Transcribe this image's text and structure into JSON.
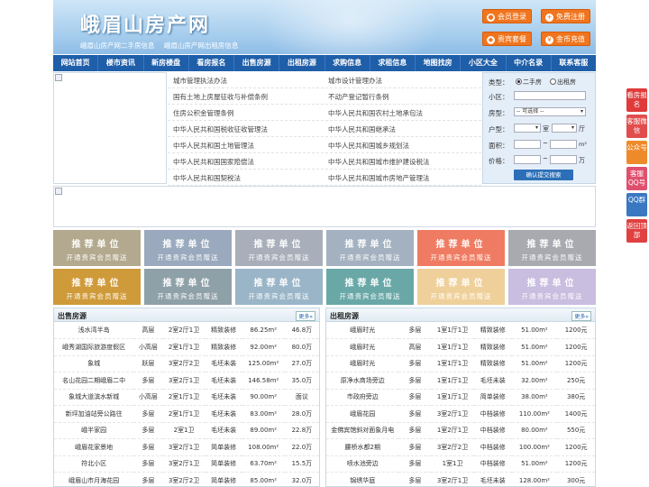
{
  "header": {
    "title": "峨眉山房产网",
    "links": [
      "峨眉山房产网二手房信息",
      "峨眉山房产网出租房信息"
    ],
    "buttons": [
      {
        "label": "会员登录",
        "icon": "user-icon"
      },
      {
        "label": "免费注册",
        "icon": "user-add-icon"
      },
      {
        "label": "贵宾套餐",
        "icon": "diamond-icon"
      },
      {
        "label": "金币充值",
        "icon": "coin-icon"
      }
    ]
  },
  "nav": [
    "网站首页",
    "楼市资讯",
    "新房楼盘",
    "看房报名",
    "出售房源",
    "出租房源",
    "求购信息",
    "求租信息",
    "地图找房",
    "小区大全",
    "中介名录",
    "联系客服"
  ],
  "law_links": [
    [
      "城市管理执法办法",
      "城市设计管理办法"
    ],
    [
      "国有土地上房屋征收与补偿条例",
      "不动产登记暂行条例"
    ],
    [
      "住房公积金管理条例",
      "中华人民共和国农村土地承包法"
    ],
    [
      "中华人民共和国税收征收管理法",
      "中华人民共和国继承法"
    ],
    [
      "中华人民共和国土地管理法",
      "中华人民共和国城乡规划法"
    ],
    [
      "中华人民共和国国家赔偿法",
      "中华人民共和国城市维护建设税法"
    ],
    [
      "中华人民共和国契税法",
      "中华人民共和国城市房地产管理法"
    ]
  ],
  "search": {
    "type_label": "类型：",
    "type_options": [
      "二手房",
      "出租房"
    ],
    "type_selected": 0,
    "community_label": "小区：",
    "housetype_label": "房型：",
    "housetype_value": "-- 可选择 --",
    "layout_label": "户型：",
    "room_unit": "室",
    "hall_unit": "厅",
    "area_label": "面积：",
    "area_unit": "m²",
    "price_label": "价格：",
    "price_unit": "万",
    "submit": "确认提交搜索"
  },
  "recommend": {
    "line1": "推荐单位",
    "line2": "开通贵宾会员赠送",
    "colors": [
      "#b3a98f",
      "#9aa9bd",
      "#a8afba",
      "#a4b1c0",
      "#ef7c62",
      "#a8aab0",
      "#cf9a3a",
      "#8fa1a8",
      "#9ab5c8",
      "#6aa8a8",
      "#efd09a",
      "#c9bde0",
      "#9cb6b6",
      "#a6b8c2"
    ]
  },
  "sale": {
    "title": "出售房源",
    "more": "更多»",
    "rows": [
      [
        "浅水湾半岛",
        "高层",
        "2室2厅1卫",
        "精致装修",
        "86.25m²",
        "46.8万"
      ],
      [
        "峨秀湖国际旅游度假区",
        "小高层",
        "2室1厅1卫",
        "精致装修",
        "92.00m²",
        "80.0万"
      ],
      [
        "象城",
        "跃层",
        "3室2厅2卫",
        "毛坯未装",
        "125.00m²",
        "27.0万"
      ],
      [
        "名山花园二期峨眉二中",
        "多层",
        "3室2厅1卫",
        "毛坯未装",
        "146.58m²",
        "35.0万"
      ],
      [
        "象城大道滨水新城",
        "小高层",
        "2室1厅1卫",
        "毛坯未装",
        "90.00m²",
        "面议"
      ],
      [
        "新坪加油站旁公路往",
        "多层",
        "2室1厅1卫",
        "毛坯未装",
        "83.00m²",
        "28.0万"
      ],
      [
        "峨半家园",
        "多层",
        "2室1卫",
        "毛坯未装",
        "89.00m²",
        "22.8万"
      ],
      [
        "峨眉花家景地",
        "多层",
        "3室2厅1卫",
        "简单装修",
        "108.00m²",
        "22.0万"
      ],
      [
        "符北小区",
        "多层",
        "3室2厅1卫",
        "简单装修",
        "63.70m²",
        "15.5万"
      ],
      [
        "峨眉山市月海花园",
        "多层",
        "3室2厅2卫",
        "简单装修",
        "85.00m²",
        "32.0万"
      ]
    ]
  },
  "rent": {
    "title": "出租房源",
    "more": "更多»",
    "rows": [
      [
        "峨眉时光",
        "多层",
        "1室1厅1卫",
        "精致装修",
        "51.00m²",
        "1200元"
      ],
      [
        "峨眉时光",
        "高层",
        "1室1厅1卫",
        "精致装修",
        "51.00m²",
        "1200元"
      ],
      [
        "峨眉时光",
        "多层",
        "1室1厅1卫",
        "精致装修",
        "51.00m²",
        "1200元"
      ],
      [
        "原净水商场旁边",
        "多层",
        "1室1厅1卫",
        "毛坯未装",
        "32.00m²",
        "250元"
      ],
      [
        "市政府旁边",
        "多层",
        "1室1厅1卫",
        "简单装修",
        "38.00m²",
        "380元"
      ],
      [
        "峨眉花园",
        "多层",
        "3室2厅1卫",
        "中档装修",
        "110.00m²",
        "1400元"
      ],
      [
        "金佛宾馆斜对面象月电",
        "多层",
        "1室2厅1卫",
        "中档装修",
        "80.00m²",
        "550元"
      ],
      [
        "腰桥水都2期",
        "多层",
        "3室2厅2卫",
        "中档装修",
        "100.00m²",
        "1200元"
      ],
      [
        "喷水池旁边",
        "多层",
        "1室1卫",
        "中档装修",
        "51.00m²",
        "1200元"
      ],
      [
        "锦绣华庭",
        "多层",
        "3室2厅1卫",
        "毛坯未装",
        "128.00m²",
        "300元"
      ]
    ]
  },
  "side": [
    {
      "label": "看房报名",
      "color": "#e03a3a"
    },
    {
      "label": "客服微信",
      "color": "#e14d4d"
    },
    {
      "label": "公众号",
      "color": "#ef8a2a"
    },
    {
      "label": "客服QQ号",
      "color": "#e0506e"
    },
    {
      "label": "QQ群",
      "color": "#3a78c2"
    },
    {
      "label": "返回顶部",
      "color": "#e04040"
    }
  ]
}
